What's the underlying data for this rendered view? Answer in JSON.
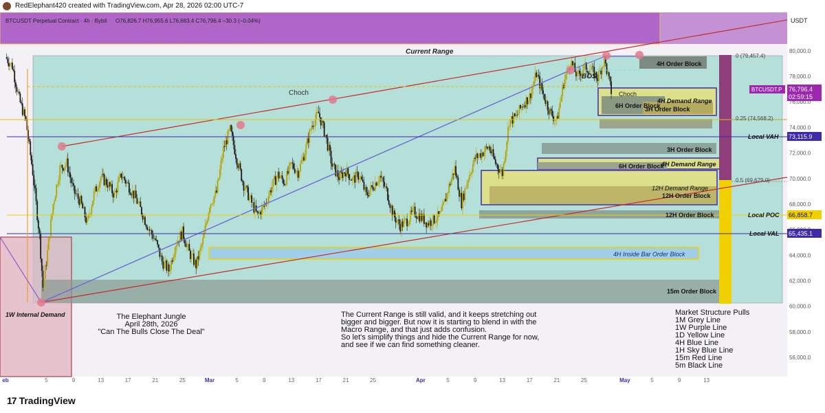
{
  "header": {
    "caption": "RedElephant420 created with TradingView.com, Apr 28, 2026 02:00 UTC-7",
    "symbol_line": "BTCUSDT Perpetual Contract · 4h · Bybit",
    "ohlc": "O76,826.7 H76,955.6 L76,683.4 C76,796.4 −30.3 (−0.04%)",
    "currency": "USDT"
  },
  "footer": {
    "brand": "TradingView"
  },
  "chart_data": {
    "type": "line",
    "ylim": [
      54500,
      83000
    ],
    "x_domain_days": [
      0,
      100
    ],
    "y_ticks": [
      56000,
      58000,
      60000,
      62000,
      64000,
      66000,
      68000,
      70000,
      72000,
      74000,
      76000,
      78000,
      80000
    ],
    "y_tick_labels": [
      "56,000.0",
      "58,000.0",
      "60,000.0",
      "62,000.0",
      "64,000.0",
      "66,000.0",
      "68,000.0",
      "70,000.0",
      "72,000.0",
      "74,000.0",
      "76,000.0",
      "78,000.0",
      "80,000.0"
    ],
    "x_ticks": [
      {
        "label": "eb",
        "d": 0
      },
      {
        "label": "5",
        "d": 6
      },
      {
        "label": "9",
        "d": 10
      },
      {
        "label": "13",
        "d": 14
      },
      {
        "label": "17",
        "d": 18
      },
      {
        "label": "21",
        "d": 22
      },
      {
        "label": "25",
        "d": 26
      },
      {
        "label": "Mar",
        "d": 30
      },
      {
        "label": "5",
        "d": 34
      },
      {
        "label": "9",
        "d": 38
      },
      {
        "label": "13",
        "d": 42
      },
      {
        "label": "17",
        "d": 46
      },
      {
        "label": "21",
        "d": 50
      },
      {
        "label": "25",
        "d": 54
      },
      {
        "label": "Apr",
        "d": 61
      },
      {
        "label": "5",
        "d": 65
      },
      {
        "label": "9",
        "d": 69
      },
      {
        "label": "13",
        "d": 73
      },
      {
        "label": "17",
        "d": 77
      },
      {
        "label": "21",
        "d": 81
      },
      {
        "label": "25",
        "d": 85
      },
      {
        "label": "May",
        "d": 91
      },
      {
        "label": "5",
        "d": 95
      },
      {
        "label": "9",
        "d": 99
      },
      {
        "label": "13",
        "d": 103
      }
    ],
    "price_path": [
      [
        0,
        79500
      ],
      [
        1,
        78800
      ],
      [
        2,
        76200
      ],
      [
        3,
        74500
      ],
      [
        4,
        70500
      ],
      [
        5,
        65500
      ],
      [
        5.5,
        61500
      ],
      [
        6,
        63500
      ],
      [
        7,
        68000
      ],
      [
        8,
        70800
      ],
      [
        9,
        71200
      ],
      [
        10,
        69000
      ],
      [
        11,
        68200
      ],
      [
        12,
        66500
      ],
      [
        13,
        68800
      ],
      [
        14,
        70100
      ],
      [
        15,
        69600
      ],
      [
        16,
        68700
      ],
      [
        17,
        70300
      ],
      [
        18,
        69500
      ],
      [
        19,
        68600
      ],
      [
        20,
        67400
      ],
      [
        21,
        66100
      ],
      [
        22,
        65200
      ],
      [
        23,
        63500
      ],
      [
        24,
        62800
      ],
      [
        25,
        64900
      ],
      [
        26,
        65800
      ],
      [
        27,
        64200
      ],
      [
        28,
        63200
      ],
      [
        29,
        65100
      ],
      [
        30,
        68000
      ],
      [
        31,
        68900
      ],
      [
        32,
        72300
      ],
      [
        33,
        73800
      ],
      [
        34,
        71500
      ],
      [
        35,
        69500
      ],
      [
        36,
        68300
      ],
      [
        37,
        67100
      ],
      [
        38,
        67800
      ],
      [
        39,
        69200
      ],
      [
        40,
        70300
      ],
      [
        41,
        69700
      ],
      [
        42,
        71100
      ],
      [
        43,
        70500
      ],
      [
        44,
        72100
      ],
      [
        45,
        74200
      ],
      [
        46,
        75100
      ],
      [
        47,
        73400
      ],
      [
        48,
        71000
      ],
      [
        49,
        70100
      ],
      [
        50,
        70600
      ],
      [
        51,
        69900
      ],
      [
        52,
        70300
      ],
      [
        53,
        68700
      ],
      [
        54,
        69400
      ],
      [
        55,
        70200
      ],
      [
        56,
        69000
      ],
      [
        57,
        67100
      ],
      [
        58,
        66300
      ],
      [
        59,
        66700
      ],
      [
        60,
        67400
      ],
      [
        61,
        67000
      ],
      [
        62,
        66500
      ],
      [
        63,
        66800
      ],
      [
        64,
        67200
      ],
      [
        65,
        69100
      ],
      [
        66,
        70800
      ],
      [
        67,
        68100
      ],
      [
        68,
        70100
      ],
      [
        69,
        71600
      ],
      [
        70,
        72000
      ],
      [
        71,
        72500
      ],
      [
        72,
        71200
      ],
      [
        73,
        70400
      ],
      [
        74,
        74500
      ],
      [
        75,
        74800
      ],
      [
        76,
        75800
      ],
      [
        77,
        76400
      ],
      [
        78,
        78200
      ],
      [
        79,
        76600
      ],
      [
        80,
        75200
      ],
      [
        81,
        74500
      ],
      [
        82,
        77500
      ],
      [
        83,
        79200
      ],
      [
        84,
        78000
      ],
      [
        85,
        78700
      ],
      [
        86,
        78500
      ],
      [
        87,
        77900
      ],
      [
        88,
        79300
      ],
      [
        89,
        76800
      ]
    ],
    "annotations": [
      {
        "text": "Current Range"
      },
      {
        "text": "Choch"
      },
      {
        "text": "BOS"
      },
      {
        "text": "Choch"
      },
      {
        "text": "4H Order Block"
      },
      {
        "text": "4H Demand Range"
      },
      {
        "text": "6H Order Block"
      },
      {
        "text": "3H Order Block"
      },
      {
        "text": "Local VAH"
      },
      {
        "text": "3H Order Block"
      },
      {
        "text": "6H Order Block"
      },
      {
        "text": "4H Demand Range"
      },
      {
        "text": "12H Demand Range"
      },
      {
        "text": "12H Order Block"
      },
      {
        "text": "12H Order Block"
      },
      {
        "text": "Local POC"
      },
      {
        "text": "Local VAL"
      },
      {
        "text": "4H Inside Bar Order Block"
      },
      {
        "text": "15m Order Block"
      },
      {
        "text": "1W Internal Demand"
      },
      {
        "text": "0 (79,457.4)"
      },
      {
        "text": "0.25 (74,568.2)"
      },
      {
        "text": "0.5 (69,679.0)"
      }
    ],
    "price_labels": [
      {
        "text": "BTCUSDT.P",
        "bg": "#9c27b0"
      },
      {
        "text": "76,796.4",
        "bg": "#9c27b0"
      },
      {
        "text": "02:59:15",
        "bg": "#9c27b0"
      },
      {
        "text": "73,115.9",
        "bg": "#3f2aa8"
      },
      {
        "text": "66,858.7",
        "bg": "#f0d000"
      },
      {
        "text": "65,435.1",
        "bg": "#3f2aa8"
      }
    ],
    "notes": {
      "title_lines": [
        "The Elephant Jungle",
        "April 28th, 2026",
        "\"Can The Bulls Close The Deal\""
      ],
      "commentary_lines": [
        "The Current Range is still valid, and it keeps stretching out",
        "bigger and bigger. But now it is starting to blend in with the",
        "Macro Range, and that just adds confusion.",
        "So let's simplify things and hide the Current Range for now,",
        "and see if we can find something cleaner."
      ],
      "legend_lines": [
        "Market Structure Pulls",
        "1M Grey Line",
        "1W Purple Line",
        "1D Yellow Line",
        "4H Blue Line",
        "1H Sky Blue Line",
        "15m Red Line",
        "5m Black Line"
      ]
    },
    "colors": {
      "current_range_fill": "#a9dcd3",
      "top_band": "#b066c9",
      "candle_up": "#b7a300",
      "candle_down": "#1a1a1a",
      "red_channel": "#c62828",
      "blue_line": "#6d68d8",
      "local_levels": "#3f2aa8",
      "poc": "#f0d000"
    }
  }
}
